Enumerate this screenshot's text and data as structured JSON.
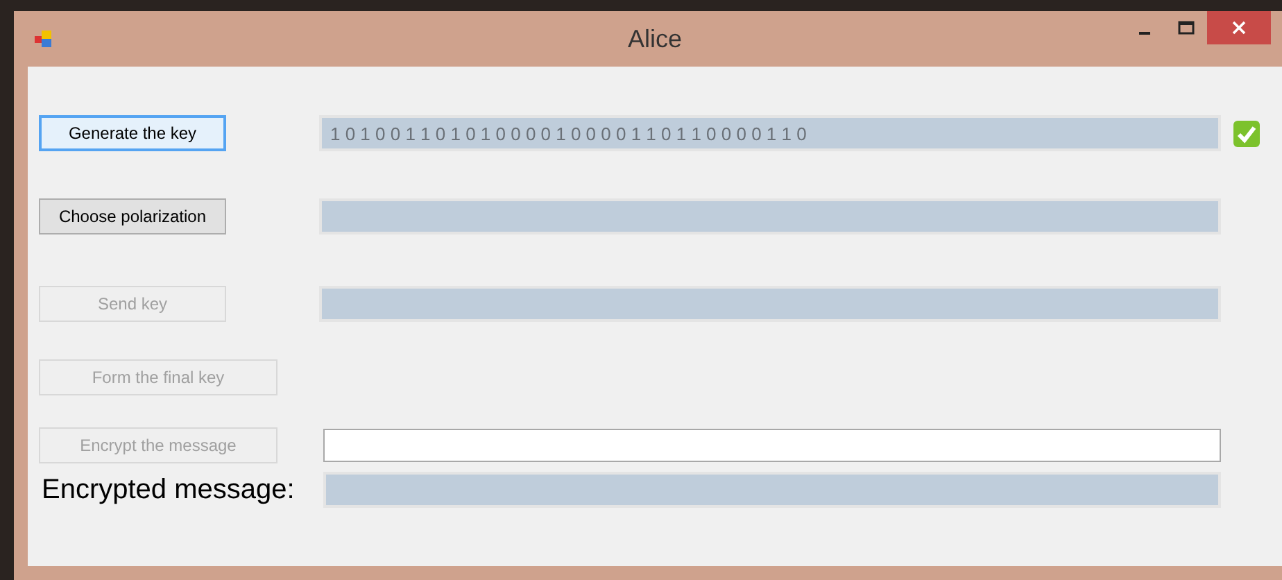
{
  "window": {
    "title": "Alice"
  },
  "rows": [
    {
      "kind": "button",
      "label": "Generate the key",
      "disabled": false,
      "focused": true,
      "field": {
        "kind": "readonly",
        "value": "1 0 1 0 0 1 1 0 1 0 1 0 0 0 0 1 0 0 0 0 1 1 0 1 1 0 0 0 0 1 1 0"
      },
      "verified": true
    },
    {
      "kind": "button",
      "label": "Choose polarization",
      "disabled": false,
      "focused": false,
      "field": {
        "kind": "readonly"
      }
    },
    {
      "kind": "button",
      "label": "Send key",
      "disabled": true,
      "focused": false,
      "field": {
        "kind": "readonly"
      }
    },
    {
      "kind": "button",
      "label": "Form the final key",
      "disabled": true,
      "focused": false
    },
    {
      "kind": "button",
      "label": "Encrypt the message",
      "disabled": true,
      "focused": false,
      "field": {
        "kind": "input"
      }
    },
    {
      "kind": "label",
      "label": "Encrypted message:",
      "field": {
        "kind": "readonly"
      }
    }
  ]
}
